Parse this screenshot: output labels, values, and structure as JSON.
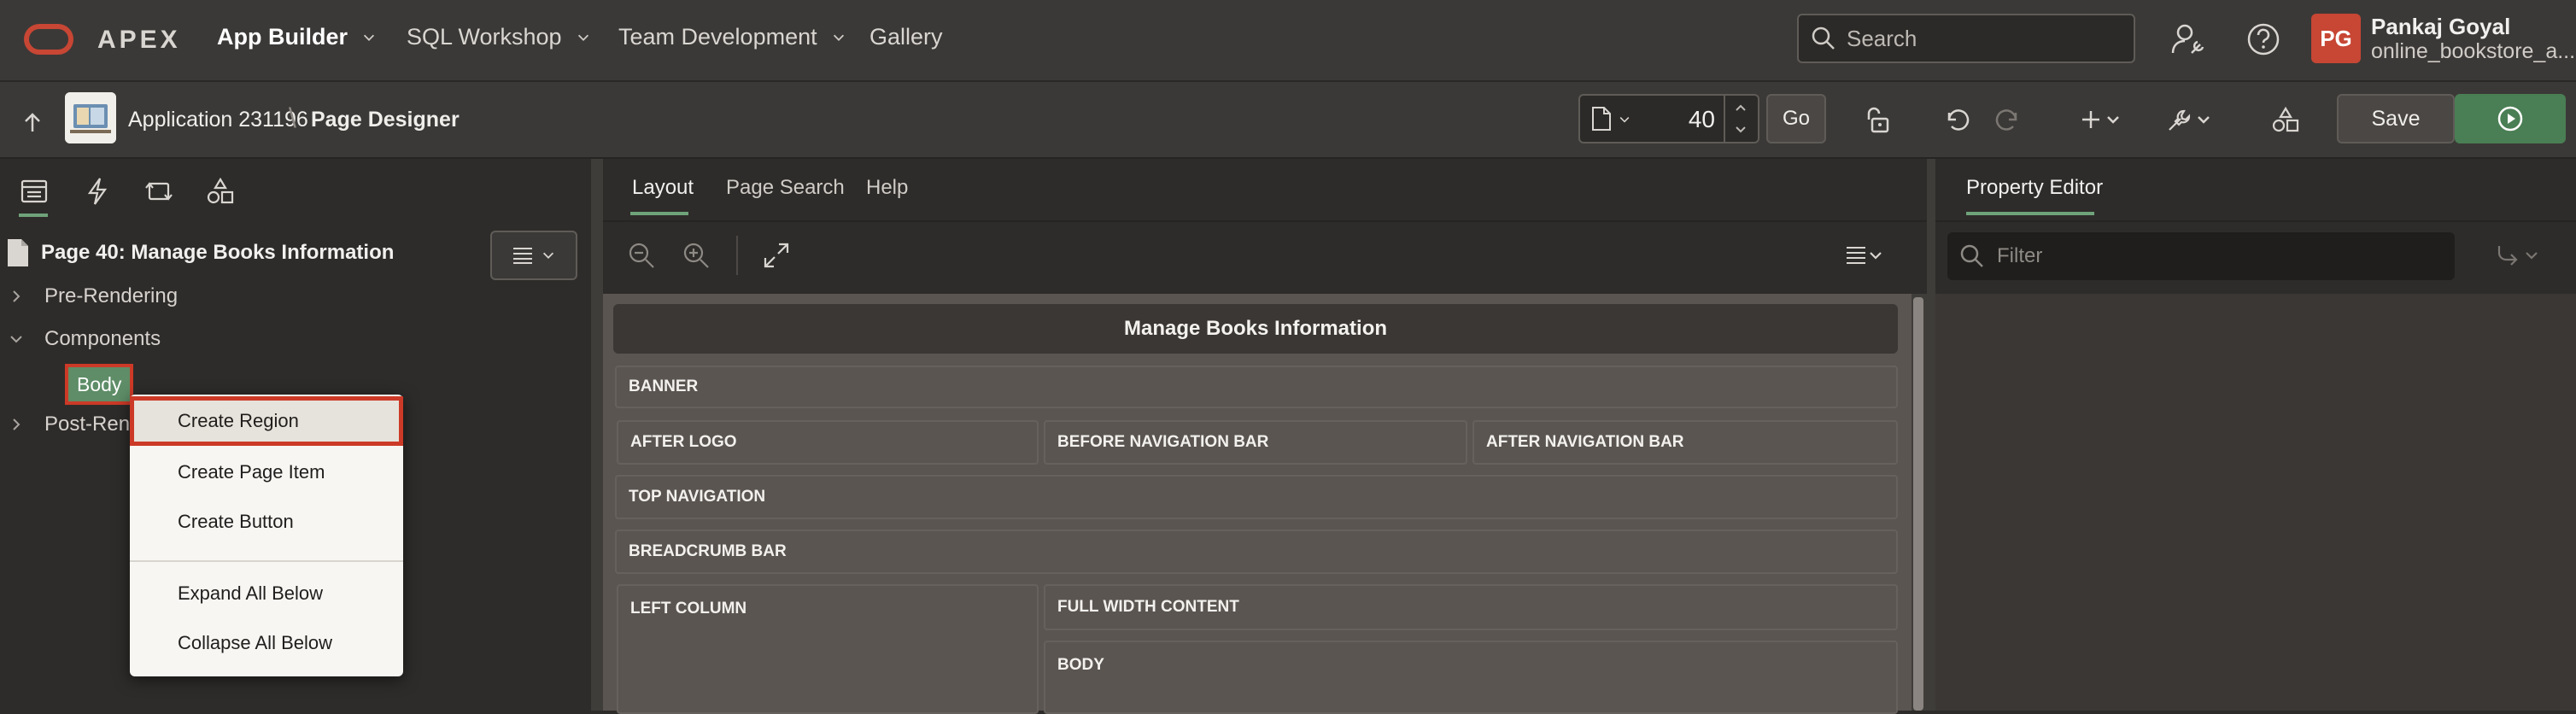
{
  "colors": {
    "brand_red": "#c74634",
    "accent_green": "#6fa37a",
    "run_green": "#4a7e54",
    "highlight_red": "#cc3a27"
  },
  "header": {
    "logo_text": "APEX",
    "nav": [
      {
        "label": "App Builder",
        "has_menu": true,
        "active": true
      },
      {
        "label": "SQL Workshop",
        "has_menu": true
      },
      {
        "label": "Team Development",
        "has_menu": true
      },
      {
        "label": "Gallery",
        "has_menu": false
      }
    ],
    "search_placeholder": "Search",
    "icons": [
      "administration-icon",
      "help-icon"
    ],
    "user": {
      "initials": "PG",
      "name": "Pankaj Goyal",
      "workspace": "online_bookstore_a..."
    }
  },
  "toolbar": {
    "app_label": "Application 231196",
    "separator": "\\",
    "page_designer_label": "Page Designer",
    "page_number": "40",
    "go_label": "Go",
    "save_label": "Save",
    "icons": [
      "page-lock-icon",
      "undo-icon",
      "redo-icon",
      "create-menu-icon",
      "utilities-menu-icon",
      "shared-components-icon",
      "run-icon"
    ]
  },
  "left_pane": {
    "tab_icons": [
      "rendering-tree-icon",
      "dynamic-actions-icon",
      "processing-icon",
      "shared-components-icon"
    ],
    "page_node_title": "Page 40: Manage Books Information",
    "tree": [
      {
        "label": "Pre-Rendering",
        "expanded": false
      },
      {
        "label": "Components",
        "expanded": true,
        "children": [
          {
            "label": "Body",
            "selected": true
          }
        ]
      },
      {
        "label": "Post-Rendering",
        "expanded": false
      }
    ],
    "context_menu": {
      "items": [
        "Create Region",
        "Create Page Item",
        "Create Button"
      ],
      "items_after_divider": [
        "Expand All Below",
        "Collapse All Below"
      ],
      "highlighted": "Create Region"
    }
  },
  "middle_pane": {
    "tabs": [
      {
        "label": "Layout",
        "active": true
      },
      {
        "label": "Page Search"
      },
      {
        "label": "Help"
      }
    ],
    "toolbar_icons": [
      "zoom-out-icon",
      "zoom-in-icon",
      "expand-icon",
      "layout-menu-icon"
    ],
    "page_title": "Manage Books Information",
    "regions": [
      "BANNER",
      "AFTER LOGO",
      "BEFORE NAVIGATION BAR",
      "AFTER NAVIGATION BAR",
      "TOP NAVIGATION",
      "BREADCRUMB BAR",
      "LEFT COLUMN",
      "FULL WIDTH CONTENT",
      "BODY"
    ]
  },
  "right_pane": {
    "title": "Property Editor",
    "filter_placeholder": "Filter"
  }
}
